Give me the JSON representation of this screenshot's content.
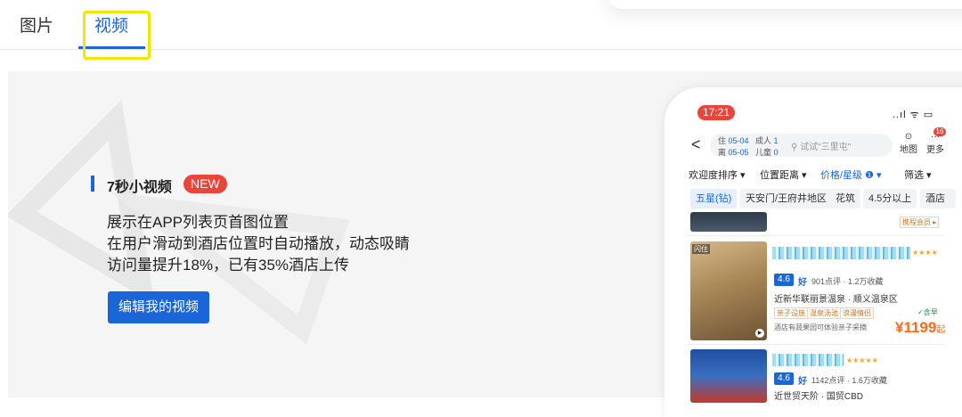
{
  "tabs": [
    {
      "label": "图片"
    },
    {
      "label": "视频"
    }
  ],
  "feature": {
    "title": "7秒小视频",
    "badge": "NEW",
    "lines": [
      "展示在APP列表页首图位置",
      "在用户滑动到酒店位置时自动播放，动态吸睛",
      "访问量提升18%，已有35%酒店上传"
    ],
    "cta": "编辑我的视频"
  },
  "phone": {
    "time": "17:21",
    "signal": "..ıl ᯤ ▭",
    "back": "<",
    "checkin": "05-04",
    "checkin_prefix": "住",
    "checkout": "05-05",
    "checkout_prefix": "离",
    "adults_label": "成人",
    "adults": "1",
    "kids_label": "儿童",
    "kids": "0",
    "search_placeholder": "试试\"三里屯\"",
    "map_label": "地图",
    "more_label": "更多",
    "badge_count": "16",
    "filters": [
      "欢迎度排序 ▾",
      "位置距离 ▾",
      "价格/星级 ❶ ▾",
      "筛选 ▾"
    ],
    "chips": [
      "五星(钻)",
      "天安门/王府井地区",
      "花筑",
      "4.5分以上",
      "酒店套"
    ],
    "member_tag": "携程会员 ▸",
    "hotel1": {
      "flash": "闪住",
      "score": "4.6",
      "rating": "好",
      "reviews": "901点评 · 1.2万收藏",
      "location": "近新华联丽景温泉 · 顺义温泉区",
      "tags": [
        "亲子设施",
        "温泉汤池",
        "浪漫情侣"
      ],
      "breakfast": "✓含早",
      "promo": "酒店有蔬果园可体验亲子采摘",
      "price": "¥1199",
      "price_suffix": "起",
      "stars": "★★★★"
    },
    "hotel2": {
      "score": "4.6",
      "rating": "好",
      "reviews": "1142点评 · 1.6万收藏",
      "location": "近世贸天阶 · 国贸CBD",
      "stars": "★★★★★"
    }
  }
}
